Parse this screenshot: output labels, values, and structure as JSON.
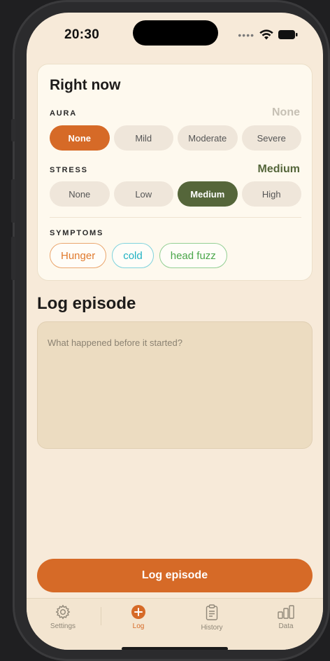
{
  "status_bar": {
    "time": "20:30"
  },
  "right_now": {
    "title": "Right now",
    "aura": {
      "label": "AURA",
      "value": "None",
      "value_color": "#c6c0b4",
      "options": [
        "None",
        "Mild",
        "Moderate",
        "Severe"
      ],
      "selected": "None"
    },
    "stress": {
      "label": "STRESS",
      "value": "Medium",
      "value_color": "#55663a",
      "options": [
        "None",
        "Low",
        "Medium",
        "High"
      ],
      "selected": "Medium"
    },
    "symptoms": {
      "label": "SYMPTOMS",
      "chips": [
        {
          "label": "Hunger",
          "color": "#e07a2e"
        },
        {
          "label": "cold",
          "color": "#1fb1c3"
        },
        {
          "label": "head fuzz",
          "color": "#4aa64a"
        }
      ]
    }
  },
  "log_episode": {
    "title": "Log episode",
    "notes_placeholder": "What happened before it started?",
    "button_label": "Log episode"
  },
  "tabbar": {
    "tabs": [
      {
        "label": "Settings",
        "icon": "gear-icon",
        "active": false
      },
      {
        "label": "Log",
        "icon": "plus-circle-icon",
        "active": true
      },
      {
        "label": "History",
        "icon": "clipboard-icon",
        "active": false
      },
      {
        "label": "Data",
        "icon": "bar-chart-icon",
        "active": false
      }
    ]
  },
  "colors": {
    "accent": "#d66a27",
    "stress_selected": "#55663a",
    "background": "#f7ead9"
  }
}
